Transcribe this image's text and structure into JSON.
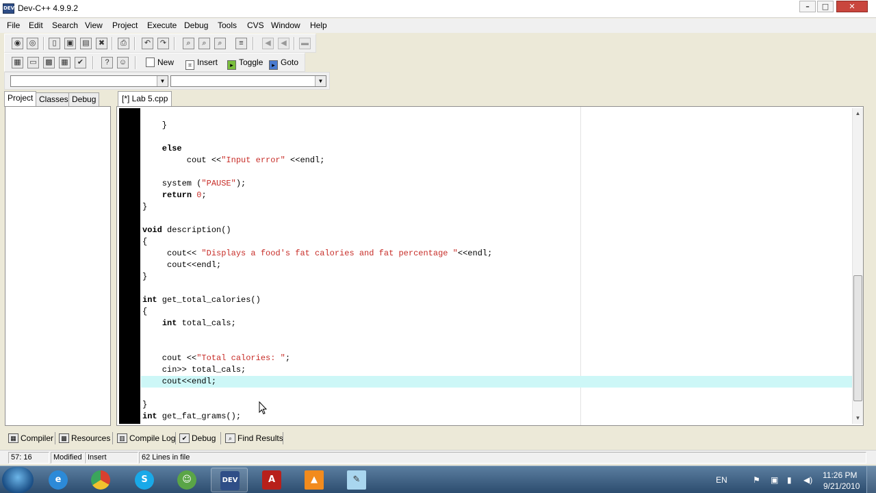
{
  "window": {
    "title": "Dev-C++ 4.9.9.2",
    "icon_label": "DEV",
    "controls": [
      "minimize-icon",
      "maximize-icon",
      "close-icon"
    ]
  },
  "menu": [
    "File",
    "Edit",
    "Search",
    "View",
    "Project",
    "Execute",
    "Debug",
    "Tools",
    "CVS",
    "Window",
    "Help"
  ],
  "toolbar2": {
    "new_label": "New",
    "insert_label": "Insert",
    "toggle_label": "Toggle",
    "goto_label": "Goto"
  },
  "class_combos": {
    "class_value": "",
    "member_value": ""
  },
  "left_tabs": [
    "Project",
    "Classes",
    "Debug"
  ],
  "editor": {
    "tab_label": "[*] Lab 5.cpp",
    "lines": [
      "    }",
      "",
      "    else",
      "         cout <<\"Input error\" <<endl;",
      "",
      "    system (\"PAUSE\");",
      "    return 0;",
      "}",
      "",
      "void description()",
      "{",
      "     cout<< \"Displays a food's fat calories and fat percentage \"<<endl;",
      "     cout<<endl;",
      "}",
      "",
      "int get_total_calories()",
      "{",
      "    int total_cals;",
      "",
      "",
      "    cout <<\"Total calories: \";",
      "    cin>> total_cals;",
      "    cout<<endl;",
      "",
      "}",
      "int get_fat_grams();"
    ],
    "active_line_text": "    cout<<endl;"
  },
  "bottom_tabs": [
    "Compiler",
    "Resources",
    "Compile Log",
    "Debug",
    "Find Results"
  ],
  "status": {
    "position": "57: 16",
    "modified": "Modified",
    "mode": "Insert",
    "lines_info": "62 Lines in file"
  },
  "taskbar": {
    "apps": [
      "internet-explorer-icon",
      "chrome-icon",
      "skype-icon",
      "messenger-icon",
      "devcpp-icon",
      "acrobat-icon",
      "vlc-icon",
      "notepad-icon"
    ],
    "language": "EN",
    "time": "11:26 PM",
    "date": "9/21/2010"
  },
  "colors": {
    "string": "#c72c27",
    "active_line": "#cdf7f7",
    "gutter": "#000000"
  }
}
